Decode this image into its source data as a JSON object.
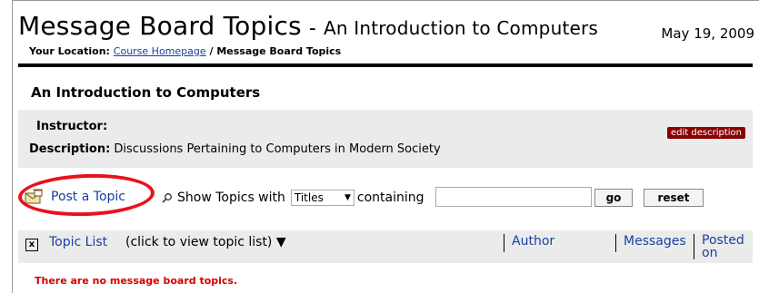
{
  "header": {
    "title": "Message Board Topics",
    "separator": "-",
    "course_title": "An Introduction to Computers",
    "date": "May 19, 2009",
    "location_label": "Your Location:",
    "breadcrumb_link": "Course Homepage",
    "breadcrumb_current": "/ Message Board Topics"
  },
  "course": {
    "name": "An Introduction to Computers",
    "instructor_label": "Instructor:",
    "description_label": "Description:",
    "description": "Discussions Pertaining to Computers in Modern Society",
    "edit_button": "edit description"
  },
  "toolbar": {
    "post_topic": "Post a Topic",
    "show_topics": "Show Topics with",
    "filter_selected": "Titles",
    "containing": "containing",
    "search_value": "",
    "go": "go",
    "reset": "reset"
  },
  "list_header": {
    "toggle": "x",
    "topic_list": "Topic List",
    "hint": "(click to view topic list) ▼",
    "author": "Author",
    "messages": "Messages",
    "posted_line1": "Posted",
    "posted_line2": "on"
  },
  "empty_message": "There are no message board topics.",
  "colors": {
    "link": "#1a3fa3",
    "highlight_circle": "#e8111b",
    "edit_button": "#8b0000",
    "empty_message": "#d40000"
  }
}
